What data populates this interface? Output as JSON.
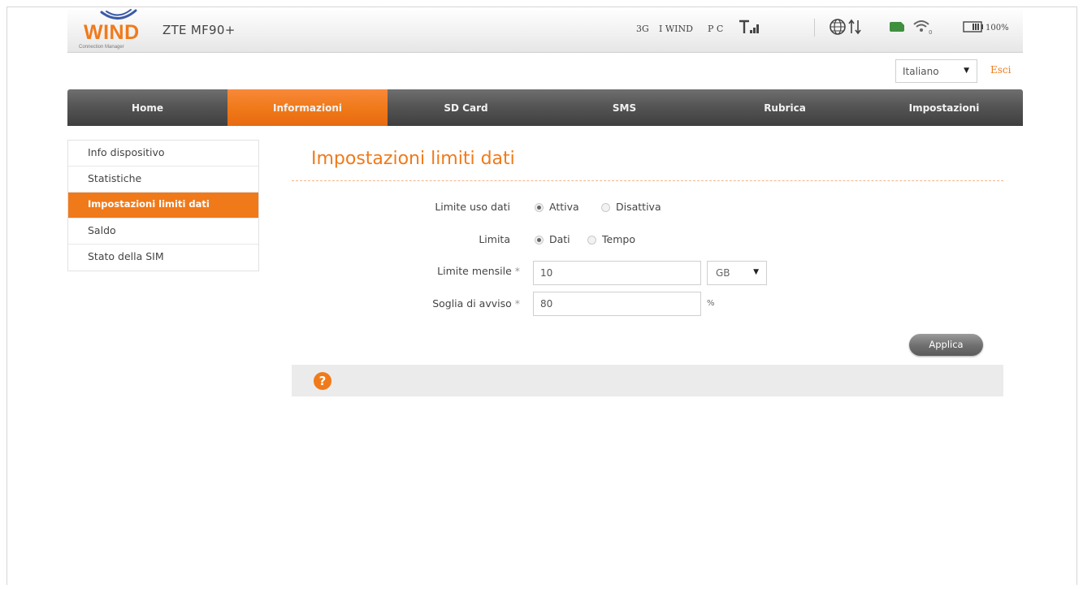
{
  "header": {
    "brand": "WIND",
    "brand_sub": "Connection Manager",
    "device_name": "ZTE MF90+",
    "network_type": "3G",
    "operator": "I WIND",
    "pc_label": "P C",
    "battery_text": "100%"
  },
  "language": {
    "selected": "Italiano"
  },
  "logout_label": "Esci",
  "nav": {
    "items": [
      {
        "label": "Home"
      },
      {
        "label": "Informazioni"
      },
      {
        "label": "SD Card"
      },
      {
        "label": "SMS"
      },
      {
        "label": "Rubrica"
      },
      {
        "label": "Impostazioni"
      }
    ],
    "active_index": 1
  },
  "sidebar": {
    "items": [
      {
        "label": "Info dispositivo"
      },
      {
        "label": "Statistiche"
      },
      {
        "label": "Impostazioni limiti dati"
      },
      {
        "label": "Saldo"
      },
      {
        "label": "Stato della SIM"
      }
    ],
    "active_index": 2
  },
  "page": {
    "title": "Impostazioni limiti dati"
  },
  "form": {
    "data_limit": {
      "label": "Limite uso dati",
      "options": [
        "Attiva",
        "Disattiva"
      ],
      "selected": "Attiva"
    },
    "limit_by": {
      "label": "Limita",
      "options": [
        "Dati",
        "Tempo"
      ],
      "selected": "Dati"
    },
    "monthly_limit": {
      "label": "Limite mensile",
      "required_mark": "*",
      "value": "10",
      "unit": "GB"
    },
    "alert_threshold": {
      "label": "Soglia di avviso",
      "required_mark": "*",
      "value": "80",
      "unit": "%"
    },
    "apply_label": "Applica"
  },
  "help": {
    "icon": "?"
  },
  "colors": {
    "accent": "#f07a1a",
    "nav_dark": "#4a4a4a",
    "help_bar": "#ebebeb"
  },
  "icons": [
    "wind-swoosh-icon",
    "signal-strength-icon",
    "globe-icon",
    "data-arrows-icon",
    "sim-card-icon",
    "wifi-icon",
    "battery-icon",
    "help-icon"
  ]
}
